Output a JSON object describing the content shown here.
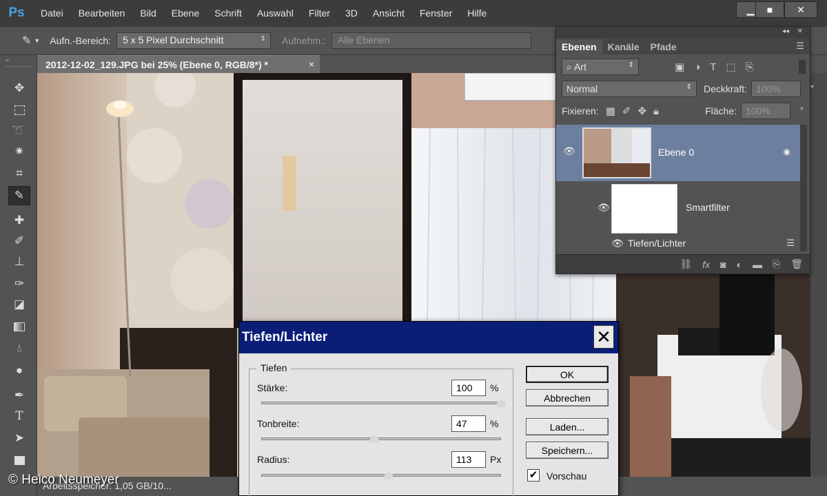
{
  "menubar": {
    "logo": "Ps",
    "items": [
      "Datei",
      "Bearbeiten",
      "Bild",
      "Ebene",
      "Schrift",
      "Auswahl",
      "Filter",
      "3D",
      "Ansicht",
      "Fenster",
      "Hilfe"
    ]
  },
  "options_bar": {
    "sample_size_label": "Aufn.-Bereich:",
    "sample_size_value": "5 x 5 Pixel Durchschnitt",
    "sample_label": "Aufnehm.:",
    "sample_value": "Alle Ebenen"
  },
  "tools": [
    "move-tool",
    "marquee-tool",
    "lasso-tool",
    "magic-wand-tool",
    "crop-tool",
    "eyedropper-tool",
    "healing-brush-tool",
    "brush-tool",
    "clone-stamp-tool",
    "history-brush-tool",
    "eraser-tool",
    "gradient-tool",
    "blur-tool",
    "dodge-tool",
    "pen-tool",
    "type-tool",
    "path-selection-tool",
    "rectangle-tool"
  ],
  "document": {
    "tab_title": "2012-12-02_129.JPG bei 25% (Ebene 0, RGB/8*) *",
    "status_text": "Arbeitsspeicher: 1,05 GB/10...",
    "copyright": "© Heico Neumeyer"
  },
  "layers_panel": {
    "tabs": [
      "Ebenen",
      "Kanäle",
      "Pfade"
    ],
    "filter_kind": "Art",
    "blend_mode": "Normal",
    "opacity_label": "Deckkraft:",
    "opacity_value": "100%",
    "lock_label": "Fixieren:",
    "fill_label": "Fläche:",
    "fill_value": "100%",
    "layer_name": "Ebene 0",
    "smartfilter_label": "Smartfilter",
    "filter_name": "Tiefen/Lichter"
  },
  "dialog": {
    "title": "Tiefen/Lichter",
    "group_label": "Tiefen",
    "fields": [
      {
        "label": "Stärke:",
        "value": "100",
        "unit": "%",
        "slider_fraction": 1.0
      },
      {
        "label": "Tonbreite:",
        "value": "47",
        "unit": "%",
        "slider_fraction": 0.47
      },
      {
        "label": "Radius:",
        "value": "113",
        "unit": "Px",
        "slider_fraction": 0.53
      }
    ],
    "buttons": {
      "ok": "OK",
      "cancel": "Abbrechen",
      "load": "Laden...",
      "save": "Speichern..."
    },
    "preview_label": "Vorschau",
    "preview_checked": true
  },
  "colors": {
    "ui_dark": "#535353",
    "menubar": "#3c3c3c",
    "dialog_title": "#0a1e78",
    "layer_selected": "#6d7f9e",
    "logo": "#4aa3df"
  }
}
